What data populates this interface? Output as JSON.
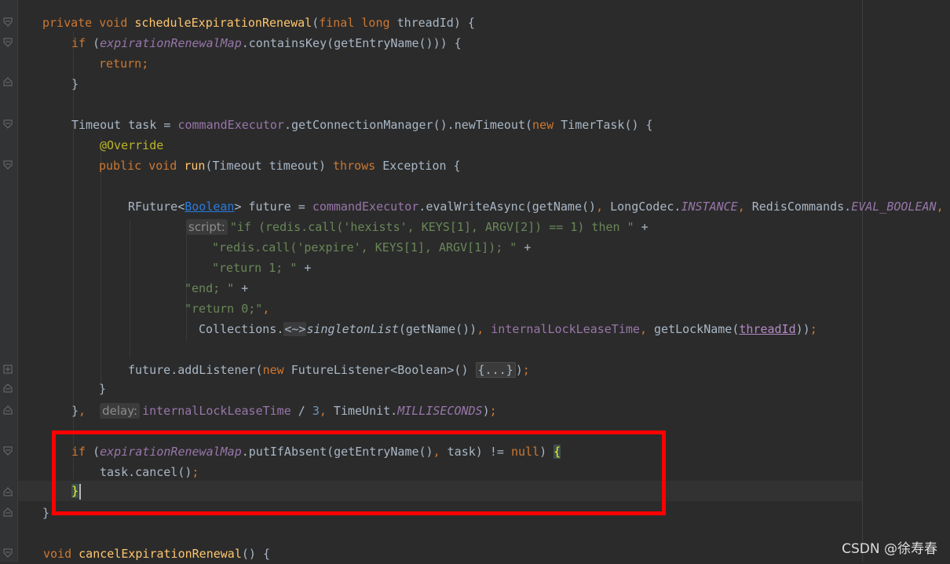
{
  "code": {
    "kw_private": "private",
    "kw_void": "void",
    "fn_schedule": "scheduleExpirationRenewal",
    "kw_final": "final",
    "kw_long": "long",
    "param_threadId": "threadId",
    "kw_if": "if",
    "fld_map": "expirationRenewalMap",
    "m_containsKey": "containsKey",
    "m_getEntryName": "getEntryName",
    "kw_return": "return",
    "cls_timeout": "Timeout",
    "var_task": "task",
    "fld_cmdExec": "commandExecutor",
    "m_getConnMgr": "getConnectionManager",
    "m_newTimeout": "newTimeout",
    "kw_new": "new",
    "cls_timertask": "TimerTask",
    "ann_override": "@Override",
    "kw_public": "public",
    "fn_run": "run",
    "param_timeout": "timeout",
    "kw_throws": "throws",
    "cls_exception": "Exception",
    "cls_rfuture": "RFuture",
    "cls_boolean_link": "Boolean",
    "var_future": "future",
    "m_evalWriteAsync": "evalWriteAsync",
    "m_getName": "getName",
    "cls_longcodec": "LongCodec",
    "const_instance": "INSTANCE",
    "cls_rediscommands": "RedisCommands",
    "const_eval_boolean": "EVAL_BOOLEAN",
    "hint_script": "script:",
    "str_1": "\"if (redis.call('hexists', KEYS[1], ARGV[2]) == 1) then \"",
    "str_2": "\"redis.call('pexpire', KEYS[1], ARGV[1]); \"",
    "str_3": "\"return 1; \"",
    "str_4": "\"end; \"",
    "str_5": "\"return 0;\"",
    "cls_collections": "Collections",
    "diamond": "<~>",
    "m_singletonList": "singletonList",
    "fld_internalLease": "internalLockLeaseTime",
    "m_getLockName": "getLockName",
    "m_addListener": "addListener",
    "cls_futurelistener": "FutureListener",
    "cls_boolean": "Boolean",
    "fold_placeholder": "{...}",
    "hint_delay": "delay:",
    "num_3": "3",
    "cls_timeunit": "TimeUnit",
    "const_millis": "MILLISECONDS",
    "m_putIfAbsent": "putIfAbsent",
    "kw_null": "null",
    "m_cancel": "cancel",
    "fn_cancelRenewal": "cancelExpirationRenewal"
  },
  "watermark": "CSDN @徐寿春"
}
